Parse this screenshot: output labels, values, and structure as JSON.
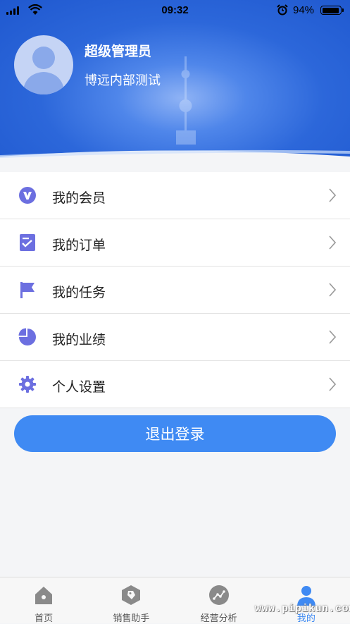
{
  "status_bar": {
    "time": "09:32",
    "battery_percent": "94%",
    "battery_level": 0.94
  },
  "profile": {
    "name": "超级管理员",
    "org": "博远内部测试"
  },
  "menu": {
    "items": [
      {
        "label": "我的会员",
        "icon": "member-v-icon"
      },
      {
        "label": "我的订单",
        "icon": "order-check-icon"
      },
      {
        "label": "我的任务",
        "icon": "flag-icon"
      },
      {
        "label": "我的业绩",
        "icon": "pie-chart-icon"
      },
      {
        "label": "个人设置",
        "icon": "gear-icon"
      }
    ]
  },
  "logout_label": "退出登录",
  "tabbar": {
    "tabs": [
      {
        "label": "首页",
        "icon": "home-icon"
      },
      {
        "label": "销售助手",
        "icon": "tag-icon"
      },
      {
        "label": "经营分析",
        "icon": "analysis-icon"
      },
      {
        "label": "我的",
        "icon": "person-icon"
      }
    ]
  },
  "watermark": "www.pipikun.com",
  "colors": {
    "accent": "#3f8af3",
    "menu_icon": "#6c6fe0",
    "header_blue": "#2c67da"
  }
}
